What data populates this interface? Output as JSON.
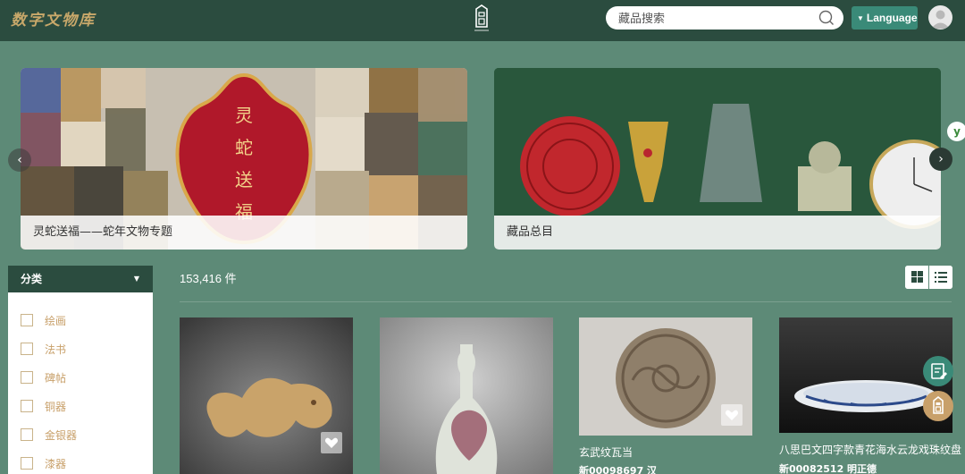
{
  "header": {
    "logo_text": "数字文物库",
    "search_placeholder": "藏品搜索",
    "language_label": "Language"
  },
  "banners": [
    {
      "caption": "灵蛇送福——蛇年文物专题",
      "art_text": [
        "灵",
        "蛇",
        "送",
        "福"
      ]
    },
    {
      "caption": "藏品总目"
    }
  ],
  "sidebar": {
    "title": "分类",
    "categories": [
      "绘画",
      "法书",
      "碑帖",
      "铜器",
      "金银器",
      "漆器"
    ]
  },
  "results": {
    "count": "153,416 件"
  },
  "cards": [
    {
      "title": "",
      "sub": ""
    },
    {
      "title": "",
      "sub": ""
    },
    {
      "title": "玄武纹瓦当",
      "sub": "新00098697  汉"
    },
    {
      "title": "八思巴文四字款青花海水云龙戏珠纹盘",
      "sub": "新00082512  明正德"
    }
  ],
  "colors": {
    "header_bg": "#2b4c3f",
    "page_bg": "#5d8a77",
    "accent": "#3a8a78",
    "category_text": "#c8a06a"
  }
}
